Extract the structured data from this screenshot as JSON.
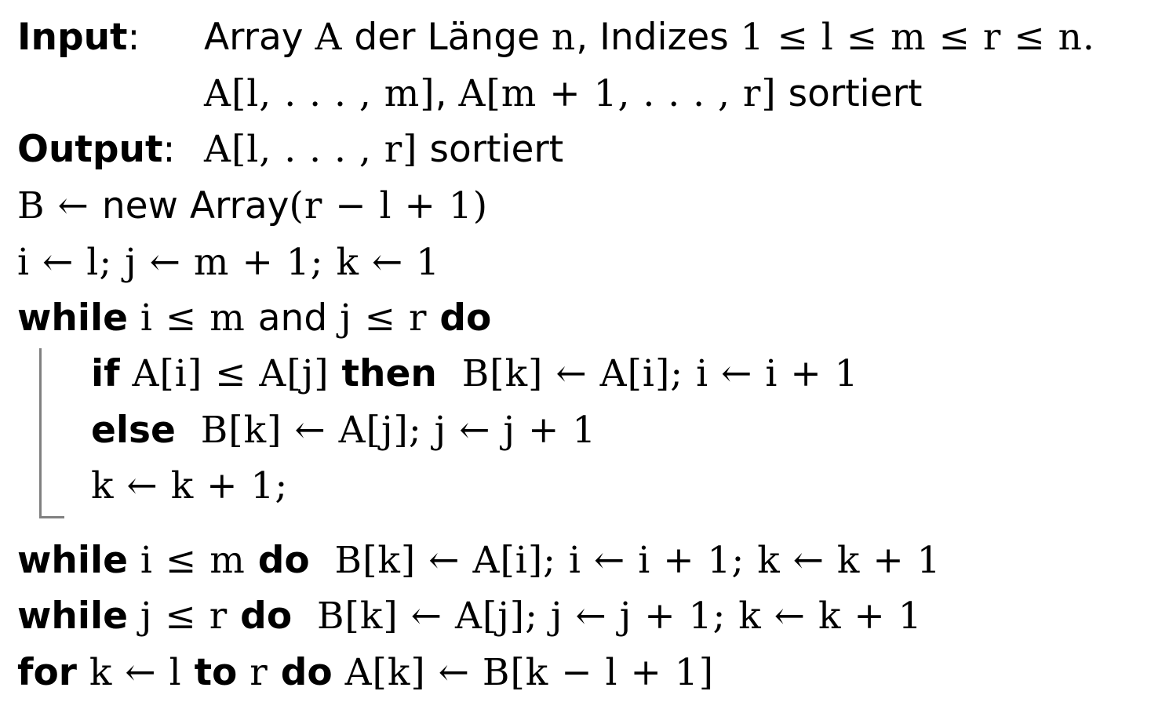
{
  "algorithm": {
    "input": {
      "label": "Input",
      "colon": ":",
      "line1_a": "Array ",
      "line1_b": "A",
      "line1_c": " der Länge ",
      "line1_d": "n",
      "line1_e": ", Indizes ",
      "line1_f": "1 ≤ l ≤ m ≤ r ≤ n.",
      "line2_a": "A[l, . . . , m]",
      "line2_b": ", ",
      "line2_c": "A[m + 1, . . . , r]",
      "line2_d": " sortiert"
    },
    "output": {
      "label": "Output",
      "colon": ":",
      "text_a": "A[l, . . . , r]",
      "text_b": " sortiert"
    },
    "line_b": {
      "a": "B ← ",
      "b": "new Array",
      "c": "(r − l + 1)"
    },
    "line_init": {
      "a": "i ← l; j ← m + 1; k ← 1"
    },
    "line_while1": {
      "kw1": "while",
      "a": " i ≤ m ",
      "b": "and",
      "c": " j ≤ r ",
      "kw2": "do"
    },
    "line_if": {
      "kw1": "if",
      "a": " A[i] ≤ A[j] ",
      "kw2": "then",
      "b": "  B[k] ← A[i]; i ← i + 1"
    },
    "line_else": {
      "kw1": "else",
      "a": "  B[k] ← A[j]; j ← j + 1"
    },
    "line_inc": {
      "a": "k ← k + 1;"
    },
    "line_while2": {
      "kw1": "while",
      "a": " i ≤ m ",
      "kw2": "do",
      "b": "  B[k] ← A[i]; i ← i + 1; k ← k + 1"
    },
    "line_while3": {
      "kw1": "while",
      "a": " j ≤ r ",
      "kw2": "do",
      "b": "  B[k] ← A[j]; j ← j + 1; k ← k + 1"
    },
    "line_for": {
      "kw1": "for",
      "a": " k ← l ",
      "kw2": "to",
      "b": " r ",
      "kw3": "do",
      "c": " A[k] ← B[k − l + 1]"
    }
  }
}
